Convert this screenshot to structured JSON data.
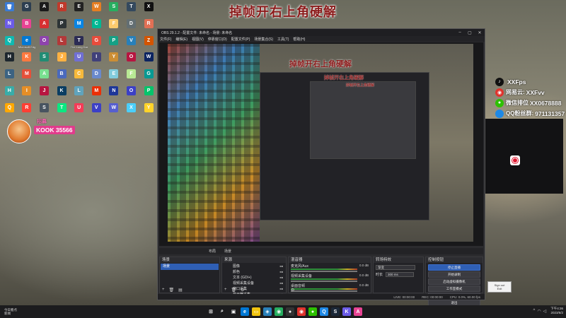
{
  "overlay": {
    "title": "掉帧开右上角硬解",
    "badge": {
      "line1": "招募",
      "line2": "KOOK 35566",
      "line3": "",
      "caption": ""
    },
    "social": [
      {
        "icon": "tiktok-icon",
        "icon_char": "♪",
        "color": "#111111",
        "label": "",
        "value": "XXFps"
      },
      {
        "icon": "netease-icon",
        "icon_char": "◉",
        "color": "#e0332d",
        "label": "网易云:",
        "value": "XXFvv"
      },
      {
        "icon": "wechat-icon",
        "icon_char": "●",
        "color": "#2dc100",
        "label": "微信排位",
        "value": "XX0678888"
      },
      {
        "icon": "qq-icon",
        "icon_char": "",
        "color": "#1e88e5",
        "label": "QQ粉丝群:",
        "value": "971131357"
      }
    ],
    "signout": {
      "line1": "Sign out",
      "line2": "Exit"
    }
  },
  "desktop_icons": [
    {
      "n": "recycle",
      "c": "",
      "col": "#3a7bd5",
      "g": "🗑"
    },
    {
      "n": "app",
      "c": "",
      "col": "#2c3e50",
      "g": "G"
    },
    {
      "n": "app",
      "c": "",
      "col": "#1a1a1a",
      "g": "A"
    },
    {
      "n": "app",
      "c": "",
      "col": "#c0392b",
      "g": "R"
    },
    {
      "n": "app",
      "c": "",
      "col": "#222",
      "g": "E"
    },
    {
      "n": "app",
      "c": "",
      "col": "#e67e22",
      "g": "W"
    },
    {
      "n": "app",
      "c": "",
      "col": "#27ae60",
      "g": "S"
    },
    {
      "n": "app",
      "c": "",
      "col": "#34495e",
      "g": "T"
    },
    {
      "n": "app",
      "c": "",
      "col": "#111",
      "g": "X"
    },
    {
      "n": "app",
      "c": "",
      "col": "#6c5ce7",
      "g": "N"
    },
    {
      "n": "app",
      "c": "",
      "col": "#e84393",
      "g": "B"
    },
    {
      "n": "app",
      "c": "",
      "col": "#d63031",
      "g": "A"
    },
    {
      "n": "app",
      "c": "",
      "col": "#2d3436",
      "g": "P"
    },
    {
      "n": "app",
      "c": "",
      "col": "#0984e3",
      "g": "M"
    },
    {
      "n": "app",
      "c": "",
      "col": "#00b894",
      "g": "C"
    },
    {
      "n": "app",
      "c": "",
      "col": "#fdcb6e",
      "g": "F"
    },
    {
      "n": "app",
      "c": "",
      "col": "#636e72",
      "g": "D"
    },
    {
      "n": "app",
      "c": "",
      "col": "#e17055",
      "g": "R"
    },
    {
      "n": "app",
      "c": "",
      "col": "#0fb9b1",
      "g": "Q"
    },
    {
      "n": "app",
      "c": "Microsoft Edge",
      "col": "#0078d4",
      "g": "e"
    },
    {
      "n": "app",
      "c": "",
      "col": "#8e44ad",
      "g": "O"
    },
    {
      "n": "app",
      "c": "",
      "col": "#b33939",
      "g": "L"
    },
    {
      "n": "app",
      "c": "The Long Dark",
      "col": "#2c2c54",
      "g": "T"
    },
    {
      "n": "app",
      "c": "",
      "col": "#e74c3c",
      "g": "G"
    },
    {
      "n": "app",
      "c": "",
      "col": "#16a085",
      "g": "P"
    },
    {
      "n": "app",
      "c": "",
      "col": "#2980b9",
      "g": "V"
    },
    {
      "n": "app",
      "c": "",
      "col": "#d35400",
      "g": "Z"
    },
    {
      "n": "app",
      "c": "",
      "col": "#1e272e",
      "g": "H"
    },
    {
      "n": "app",
      "c": "",
      "col": "#ff793f",
      "g": "K"
    },
    {
      "n": "app",
      "c": "",
      "col": "#218c74",
      "g": "S"
    },
    {
      "n": "app",
      "c": "",
      "col": "#ffb142",
      "g": "J"
    },
    {
      "n": "app",
      "c": "",
      "col": "#706fd3",
      "g": "U"
    },
    {
      "n": "app",
      "c": "",
      "col": "#40407a",
      "g": "I"
    },
    {
      "n": "app",
      "c": "",
      "col": "#cc8e35",
      "g": "Y"
    },
    {
      "n": "app",
      "c": "",
      "col": "#b71540",
      "g": "O"
    },
    {
      "n": "app",
      "c": "",
      "col": "#0c2461",
      "g": "W"
    },
    {
      "n": "app",
      "c": "",
      "col": "#3c6382",
      "g": "L"
    },
    {
      "n": "app",
      "c": "",
      "col": "#e55039",
      "g": "M"
    },
    {
      "n": "app",
      "c": "",
      "col": "#78e08f",
      "g": "A"
    },
    {
      "n": "app",
      "c": "",
      "col": "#4a69bd",
      "g": "B"
    },
    {
      "n": "app",
      "c": "",
      "col": "#f6b93b",
      "g": "C"
    },
    {
      "n": "app",
      "c": "",
      "col": "#6a89cc",
      "g": "D"
    },
    {
      "n": "app",
      "c": "",
      "col": "#82ccdd",
      "g": "E"
    },
    {
      "n": "app",
      "c": "",
      "col": "#b8e994",
      "g": "F"
    },
    {
      "n": "app",
      "c": "",
      "col": "#079992",
      "g": "G"
    },
    {
      "n": "app",
      "c": "",
      "col": "#38ada9",
      "g": "H"
    },
    {
      "n": "app",
      "c": "",
      "col": "#e58e26",
      "g": "I"
    },
    {
      "n": "app",
      "c": "",
      "col": "#b71540",
      "g": "J"
    },
    {
      "n": "app",
      "c": "",
      "col": "#0a3d62",
      "g": "K"
    },
    {
      "n": "app",
      "c": "",
      "col": "#60a3bc",
      "g": "L"
    },
    {
      "n": "app",
      "c": "",
      "col": "#eb2f06",
      "g": "M"
    },
    {
      "n": "app",
      "c": "",
      "col": "#1e3799",
      "g": "N"
    },
    {
      "n": "app",
      "c": "",
      "col": "#3c40c6",
      "g": "O"
    },
    {
      "n": "app",
      "c": "",
      "col": "#05c46b",
      "g": "P"
    },
    {
      "n": "app",
      "c": "",
      "col": "#ffa801",
      "g": "Q"
    },
    {
      "n": "app",
      "c": "",
      "col": "#ff3f34",
      "g": "R"
    },
    {
      "n": "app",
      "c": "",
      "col": "#485460",
      "g": "S"
    },
    {
      "n": "app",
      "c": "",
      "col": "#0be881",
      "g": "T"
    },
    {
      "n": "app",
      "c": "",
      "col": "#f53b57",
      "g": "U"
    },
    {
      "n": "app",
      "c": "",
      "col": "#3c40c6",
      "g": "V"
    },
    {
      "n": "app",
      "c": "",
      "col": "#575fcf",
      "g": "W"
    },
    {
      "n": "app",
      "c": "",
      "col": "#4bcffa",
      "g": "X"
    },
    {
      "n": "app",
      "c": "",
      "col": "#ffd32a",
      "g": "Y"
    }
  ],
  "obs": {
    "title": "OBS 29.1.2 - 配置文件: 未命名 - 场景: 未命名",
    "menu": [
      "文件(F)",
      "编辑(E)",
      "视图(V)",
      "停靠窗口(D)",
      "配置文件(P)",
      "场景集合(S)",
      "工具(T)",
      "帮助(H)"
    ],
    "preview_title": "掉帧开右上角硬解",
    "dock_tabs": [
      "布局",
      "场景"
    ],
    "scenes": {
      "header": "场景",
      "items": [
        "场景"
      ]
    },
    "sources": {
      "header": "来源",
      "items": [
        "图像",
        "颜色",
        "文本 (GDI+)",
        "视频采集设备",
        "窗口采集",
        "显示器采集"
      ]
    },
    "mixer": {
      "header": "混音器",
      "channels": [
        {
          "name": "麦克风/Aux",
          "db": "0.0 dB"
        },
        {
          "name": "视频采集设备",
          "db": "0.0 dB"
        },
        {
          "name": "桌面音频",
          "db": "0.0 dB"
        }
      ]
    },
    "transitions": {
      "header": "转场特效",
      "type": "渐变",
      "duration_label": "时长",
      "duration": "300 ms"
    },
    "controls": {
      "header": "控制按钮",
      "buttons": [
        "停止直播",
        "开始录制",
        "启动虚拟摄像机",
        "工作室模式",
        "设置",
        "退出"
      ]
    },
    "status": {
      "live": "LIVE: 00:00:00",
      "rec": "REC: 00:00:00",
      "cpu": "CPU: 0.0%, 60.00 fps"
    }
  },
  "taskbar": {
    "weather": "今日看点",
    "weather2": "新闻",
    "time": "下午4:36",
    "date": "2023/6/2",
    "apps": [
      {
        "n": "start-icon",
        "g": "⊞",
        "col": "#1c1c1e"
      },
      {
        "n": "search-icon",
        "g": "⌕",
        "col": "#1c1c1e"
      },
      {
        "n": "task-view-icon",
        "g": "▣",
        "col": "#1c1c1e"
      },
      {
        "n": "edge-icon",
        "g": "e",
        "col": "#0078d4"
      },
      {
        "n": "file-explorer-icon",
        "g": "▭",
        "col": "#f1c40f"
      },
      {
        "n": "store-icon",
        "g": "◈",
        "col": "#2980b9"
      },
      {
        "n": "chrome-icon",
        "g": "◉",
        "col": "#27ae60"
      },
      {
        "n": "obs-icon",
        "g": "●",
        "col": "#333"
      },
      {
        "n": "netease-icon",
        "g": "◉",
        "col": "#e0332d"
      },
      {
        "n": "wechat-icon",
        "g": "●",
        "col": "#2dc100"
      },
      {
        "n": "qq-icon",
        "g": "Q",
        "col": "#1e88e5"
      },
      {
        "n": "steam-icon",
        "g": "S",
        "col": "#1b2838"
      },
      {
        "n": "kook-icon",
        "g": "K",
        "col": "#6c5ce7"
      },
      {
        "n": "app-icon",
        "g": "A",
        "col": "#e84393"
      }
    ]
  }
}
